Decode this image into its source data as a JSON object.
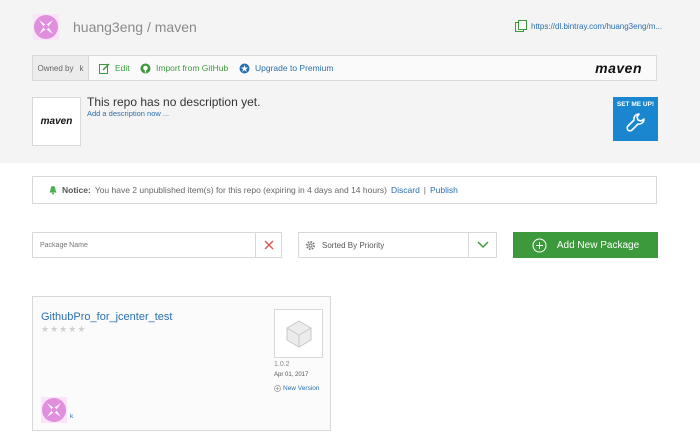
{
  "header": {
    "owner": "huang3eng",
    "separator": "/",
    "repo": "maven",
    "download_link": "https://dl.bintray.com/huang3eng/m..."
  },
  "toolbar": {
    "owned_by_label": "Owned by",
    "owned_by_value": "k",
    "edit_label": "Edit",
    "import_label": "Import from GitHub",
    "premium_label": "Upgrade to Premium",
    "repo_type_logo": "maven"
  },
  "description": {
    "logo_text": "maven",
    "text": "This repo has no description yet.",
    "add_link": "Add a description now ..."
  },
  "set_me_up": {
    "label": "SET ME UP!",
    "icon": "wrench-icon"
  },
  "notice": {
    "label": "Notice:",
    "text": "You have 2 unpublished item(s) for this repo (expiring in 4 days and 14 hours)",
    "discard": "Discard",
    "separator": "|",
    "publish": "Publish"
  },
  "filters": {
    "search_placeholder": "Package Name",
    "sort_label": "Sorted By Priority",
    "add_button": "Add New Package"
  },
  "packages": [
    {
      "name": "GithubPro_for_jcenter_test",
      "rating": 0,
      "max_rating": 5,
      "version": "1.0.2",
      "date": "Apr 01, 2017",
      "new_version_label": "New Version",
      "owner": "k"
    }
  ],
  "colors": {
    "accent_green": "#3c9a3c",
    "link_blue": "#2a6fb0",
    "set_me_up_blue": "#1a86cf",
    "avatar_pink": "#e08fdc"
  }
}
